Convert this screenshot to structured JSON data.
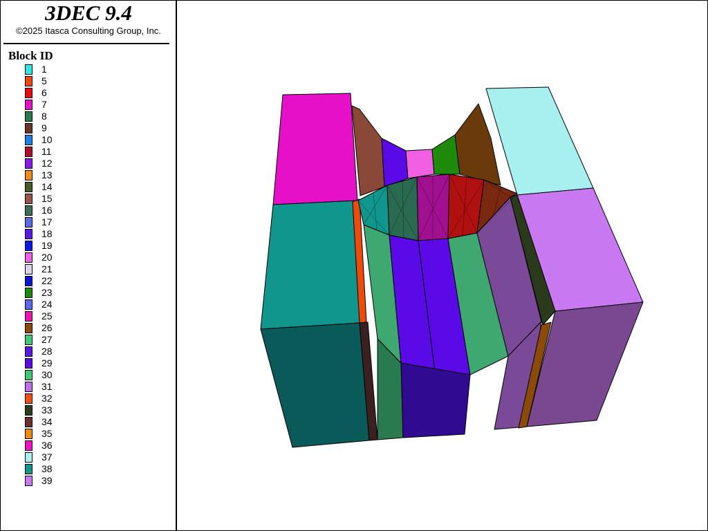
{
  "app": {
    "title": "3DEC 9.4",
    "copyright": "©2025 Itasca Consulting Group, Inc."
  },
  "legend": {
    "title": "Block  ID",
    "items": [
      {
        "label": "1",
        "color": "#2ee6e6"
      },
      {
        "label": "5",
        "color": "#f04a0a"
      },
      {
        "label": "6",
        "color": "#e60a0a"
      },
      {
        "label": "7",
        "color": "#e610c8"
      },
      {
        "label": "8",
        "color": "#2a7a50"
      },
      {
        "label": "9",
        "color": "#6a3426"
      },
      {
        "label": "10",
        "color": "#1a82e6"
      },
      {
        "label": "11",
        "color": "#b0102a"
      },
      {
        "label": "12",
        "color": "#8a1ae6"
      },
      {
        "label": "13",
        "color": "#f08a1a"
      },
      {
        "label": "14",
        "color": "#465e26"
      },
      {
        "label": "15",
        "color": "#9a5448"
      },
      {
        "label": "16",
        "color": "#3e6e5a"
      },
      {
        "label": "17",
        "color": "#5a6ae6"
      },
      {
        "label": "18",
        "color": "#5a1ae6"
      },
      {
        "label": "19",
        "color": "#0a1ae6"
      },
      {
        "label": "20",
        "color": "#f060e0"
      },
      {
        "label": "21",
        "color": "#dcd2f0"
      },
      {
        "label": "22",
        "color": "#0a16d2"
      },
      {
        "label": "23",
        "color": "#1e8a0a"
      },
      {
        "label": "24",
        "color": "#5a6ae6"
      },
      {
        "label": "25",
        "color": "#f010b4"
      },
      {
        "label": "26",
        "color": "#8a4a0a"
      },
      {
        "label": "27",
        "color": "#3ec878"
      },
      {
        "label": "28",
        "color": "#5a1ae6"
      },
      {
        "label": "29",
        "color": "#5a0ae6"
      },
      {
        "label": "30",
        "color": "#3ec878"
      },
      {
        "label": "31",
        "color": "#c070e6"
      },
      {
        "label": "32",
        "color": "#f0500a"
      },
      {
        "label": "33",
        "color": "#2a3e1a"
      },
      {
        "label": "34",
        "color": "#6a3030"
      },
      {
        "label": "35",
        "color": "#f08a0a"
      },
      {
        "label": "36",
        "color": "#f010c8"
      },
      {
        "label": "37",
        "color": "#a8f0f0"
      },
      {
        "label": "38",
        "color": "#10968c"
      },
      {
        "label": "39",
        "color": "#c878f0"
      }
    ]
  },
  "model": {
    "faces": [
      {
        "name": "face-left-top",
        "color": "#e610c8"
      },
      {
        "name": "face-left-upper-front",
        "color": "#10968c"
      },
      {
        "name": "face-left-lower-front",
        "color": "#0a5a5a"
      },
      {
        "name": "face-orange-joint",
        "color": "#f04a0a"
      },
      {
        "name": "face-dark-joint",
        "color": "#3a2020"
      },
      {
        "name": "face-back-brown",
        "color": "#8a4838"
      },
      {
        "name": "face-back-purple",
        "color": "#5a0ae6"
      },
      {
        "name": "face-back-pink",
        "color": "#f060e0"
      },
      {
        "name": "face-back-green",
        "color": "#1e8a0a"
      },
      {
        "name": "face-back-darkbrown",
        "color": "#6a3a0a"
      },
      {
        "name": "face-right-top",
        "color": "#a8f0f0"
      },
      {
        "name": "face-right-upper",
        "color": "#c878f0"
      },
      {
        "name": "face-right-lower",
        "color": "#7a4890"
      },
      {
        "name": "face-tunnel-green-left",
        "color": "#3ea870"
      },
      {
        "name": "face-tunnel-purple-left",
        "color": "#5a0ae6"
      },
      {
        "name": "face-tunnel-purple-right",
        "color": "#5a0ae6"
      },
      {
        "name": "face-tunnel-green-right",
        "color": "#3ea870"
      },
      {
        "name": "face-tunnel-violet",
        "color": "#7a4a98"
      },
      {
        "name": "face-lower-green",
        "color": "#2a7a50"
      },
      {
        "name": "face-lower-indigo",
        "color": "#300a90"
      },
      {
        "name": "face-lower-violet",
        "color": "#7a4a98"
      },
      {
        "name": "face-dark-slab",
        "color": "#2a3a1a"
      },
      {
        "name": "face-brown-joint",
        "color": "#8a4a0a"
      },
      {
        "name": "face-mesh-cyan",
        "color": "#10968c"
      },
      {
        "name": "face-mesh-green",
        "color": "#2a6a50"
      },
      {
        "name": "face-mesh-magenta",
        "color": "#a01090"
      },
      {
        "name": "face-mesh-red",
        "color": "#b01010"
      },
      {
        "name": "face-mesh-brown",
        "color": "#7a2810"
      }
    ]
  }
}
